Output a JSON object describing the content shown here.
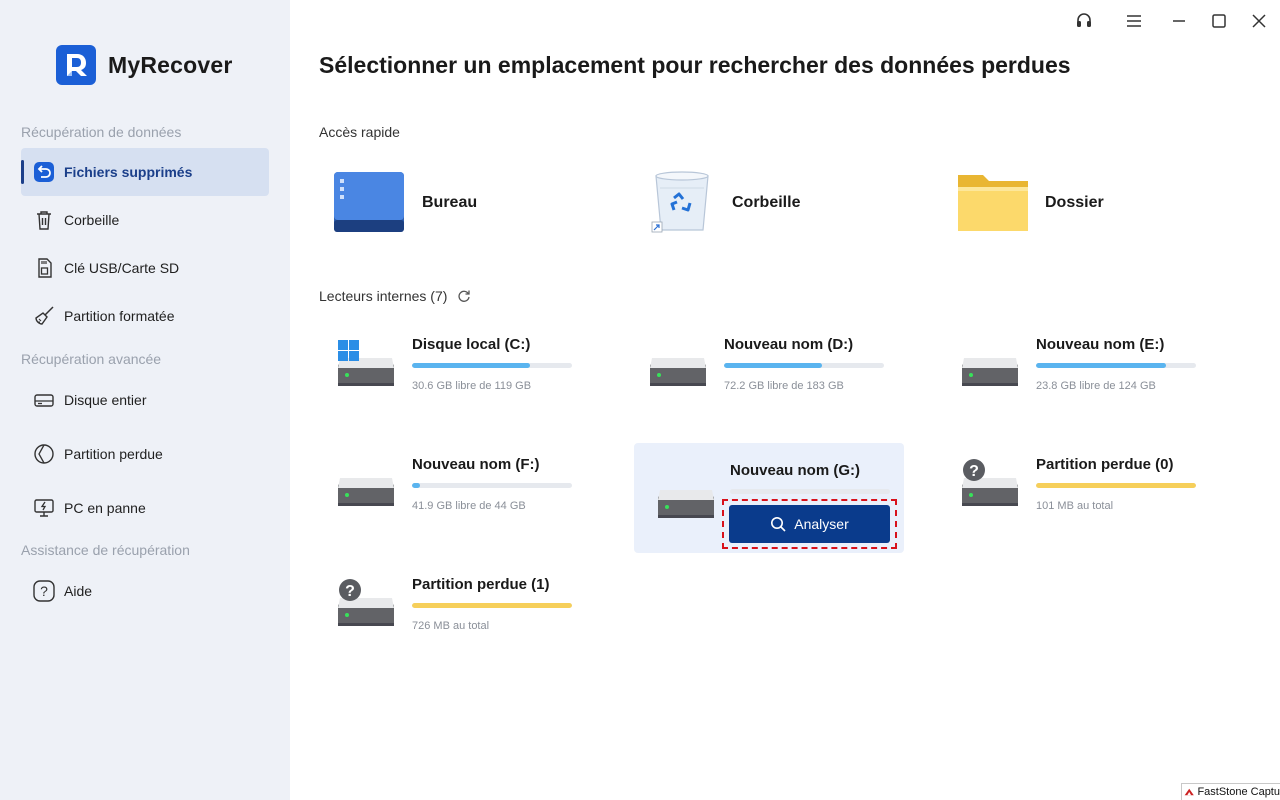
{
  "app": {
    "name": "MyRecover"
  },
  "sidebar": {
    "sections": [
      {
        "title": "Récupération de données"
      },
      {
        "title": "Récupération avancée"
      },
      {
        "title": "Assistance de récupération"
      }
    ],
    "items": [
      {
        "label": "Fichiers supprimés",
        "icon": "deleted-files-icon",
        "active": true
      },
      {
        "label": "Corbeille",
        "icon": "trash-icon"
      },
      {
        "label": "Clé USB/Carte SD",
        "icon": "sd-card-icon"
      },
      {
        "label": "Partition formatée",
        "icon": "broom-icon"
      },
      {
        "label": "Disque entier",
        "icon": "disk-icon"
      },
      {
        "label": "Partition perdue",
        "icon": "lost-partition-icon"
      },
      {
        "label": "PC en panne",
        "icon": "crashed-pc-icon"
      },
      {
        "label": "Aide",
        "icon": "help-icon"
      }
    ]
  },
  "main": {
    "title": "Sélectionner un emplacement pour rechercher des données perdues",
    "quick_access": {
      "title": "Accès rapide",
      "items": [
        {
          "label": "Bureau",
          "icon": "desktop-icon"
        },
        {
          "label": "Corbeille",
          "icon": "recycle-bin-icon"
        },
        {
          "label": "Dossier",
          "icon": "folder-icon"
        }
      ]
    },
    "drives_title": "Lecteurs internes (7)",
    "drives": [
      {
        "name": "Disque local (C:)",
        "info": "30.6 GB libre de 119 GB",
        "used_fraction": 0.74,
        "color": "#5ab4ef",
        "windows": true
      },
      {
        "name": "Nouveau nom (D:)",
        "info": "72.2 GB libre de 183 GB",
        "used_fraction": 0.61,
        "color": "#5ab4ef"
      },
      {
        "name": "Nouveau nom (E:)",
        "info": "23.8 GB libre de 124 GB",
        "used_fraction": 0.81,
        "color": "#5ab4ef"
      },
      {
        "name": "Nouveau nom (F:)",
        "info": "41.9 GB libre de 44 GB",
        "used_fraction": 0.05,
        "color": "#5ab4ef"
      },
      {
        "name": "Nouveau nom (G:)",
        "info": "",
        "used_fraction": 0.0,
        "color": "#5ab4ef",
        "hover": true
      },
      {
        "name": "Partition perdue (0)",
        "info": "101 MB au total",
        "used_fraction": 1.0,
        "color": "#f6cf5a",
        "lost": true
      },
      {
        "name": "Partition perdue (1)",
        "info": "726 MB au total",
        "used_fraction": 1.0,
        "color": "#f6cf5a",
        "lost": true
      }
    ],
    "scan_button": "Analyser"
  },
  "watermark": "FastStone Captu"
}
